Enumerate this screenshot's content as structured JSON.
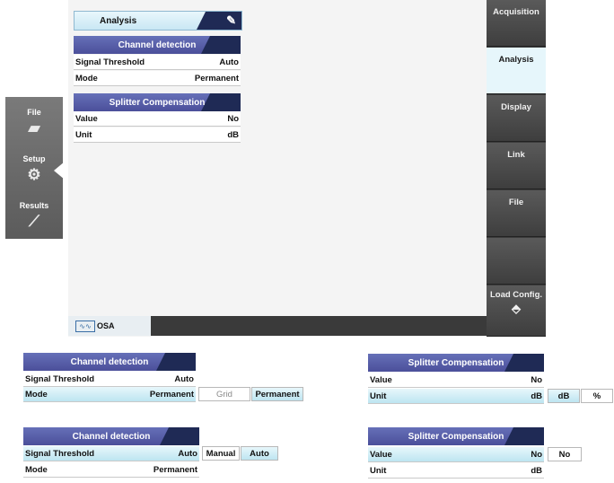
{
  "analysis": {
    "title": "Analysis"
  },
  "channel_detection": {
    "title": "Channel detection",
    "rows": [
      {
        "label": "Signal Threshold",
        "value": "Auto"
      },
      {
        "label": "Mode",
        "value": "Permanent"
      }
    ]
  },
  "splitter_compensation": {
    "title": "Splitter Compensation",
    "rows": [
      {
        "label": "Value",
        "value": "No"
      },
      {
        "label": "Unit",
        "value": "dB"
      }
    ]
  },
  "status": {
    "module": "OSA"
  },
  "right_nav": [
    "Acquisition",
    "Analysis",
    "Display",
    "Link",
    "File",
    "",
    "Load Config."
  ],
  "left_nav": [
    {
      "label": "File",
      "icon": "folder-icon"
    },
    {
      "label": "Setup",
      "icon": "gear-icon"
    },
    {
      "label": "Results",
      "icon": "chart-icon"
    }
  ],
  "panel_mode": {
    "title": "Channel detection",
    "rows": [
      {
        "label": "Signal Threshold",
        "value": "Auto"
      },
      {
        "label": "Mode",
        "value": "Permanent"
      }
    ],
    "options": [
      "Grid",
      "Permanent"
    ]
  },
  "panel_unit": {
    "title": "Splitter Compensation",
    "rows": [
      {
        "label": "Value",
        "value": "No"
      },
      {
        "label": "Unit",
        "value": "dB"
      }
    ],
    "options": [
      "dB",
      "%"
    ]
  },
  "panel_threshold": {
    "title": "Channel detection",
    "rows": [
      {
        "label": "Signal Threshold",
        "value": "Auto"
      },
      {
        "label": "Mode",
        "value": "Permanent"
      }
    ],
    "options": [
      "Manual",
      "Auto"
    ]
  },
  "panel_value": {
    "title": "Splitter Compensation",
    "rows": [
      {
        "label": "Value",
        "value": "No"
      },
      {
        "label": "Unit",
        "value": "dB"
      }
    ],
    "options": [
      "No"
    ]
  }
}
